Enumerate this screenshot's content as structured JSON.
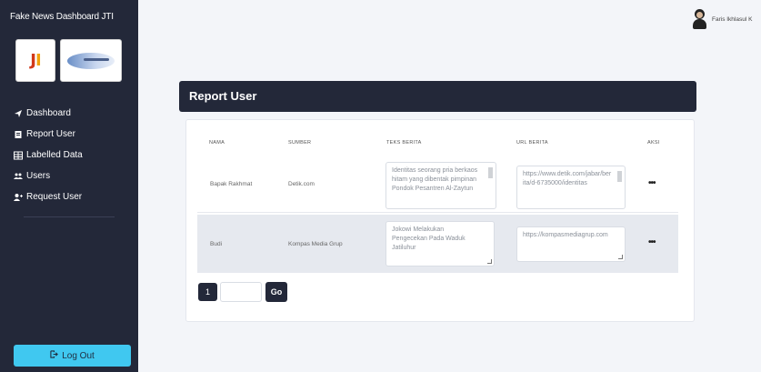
{
  "app": {
    "title": "Fake News Dashboard JTI"
  },
  "sidebar": {
    "items": [
      {
        "label": "Dashboard",
        "icon": "send-icon"
      },
      {
        "label": "Report User",
        "icon": "report-icon"
      },
      {
        "label": "Labelled Data",
        "icon": "table-icon"
      },
      {
        "label": "Users",
        "icon": "users-icon"
      },
      {
        "label": "Request User",
        "icon": "user-plus-icon"
      }
    ],
    "logout_label": "Log Out"
  },
  "user": {
    "name": "Faris Ikhlasul K"
  },
  "page": {
    "title": "Report User"
  },
  "table": {
    "headers": [
      "NAMA",
      "SUMBER",
      "TEKS BERITA",
      "URL BERITA",
      "AKSI"
    ],
    "rows": [
      {
        "nama": "Bapak Rakhmat",
        "sumber": "Detik.com",
        "teks": "Identitas seorang pria berkaos hitam yang dibentak pimpinan Pondok Pesantren Al-Zaytun",
        "url": "https://www.detik.com/jabar/berita/d-6735000/identitas",
        "aksi": "•••"
      },
      {
        "nama": "Budi",
        "sumber": "Kompas Media Grup",
        "teks": "Jokowi Melakukan Pengecekan Pada Waduk Jatiluhur",
        "url": "https://kompasmediagrup.com",
        "aksi": "•••"
      }
    ]
  },
  "pagination": {
    "page": "1",
    "input_value": "",
    "go_label": "Go"
  },
  "colors": {
    "sidebar": "#232839",
    "accent": "#40c8f0",
    "background": "#f3f5f9"
  }
}
